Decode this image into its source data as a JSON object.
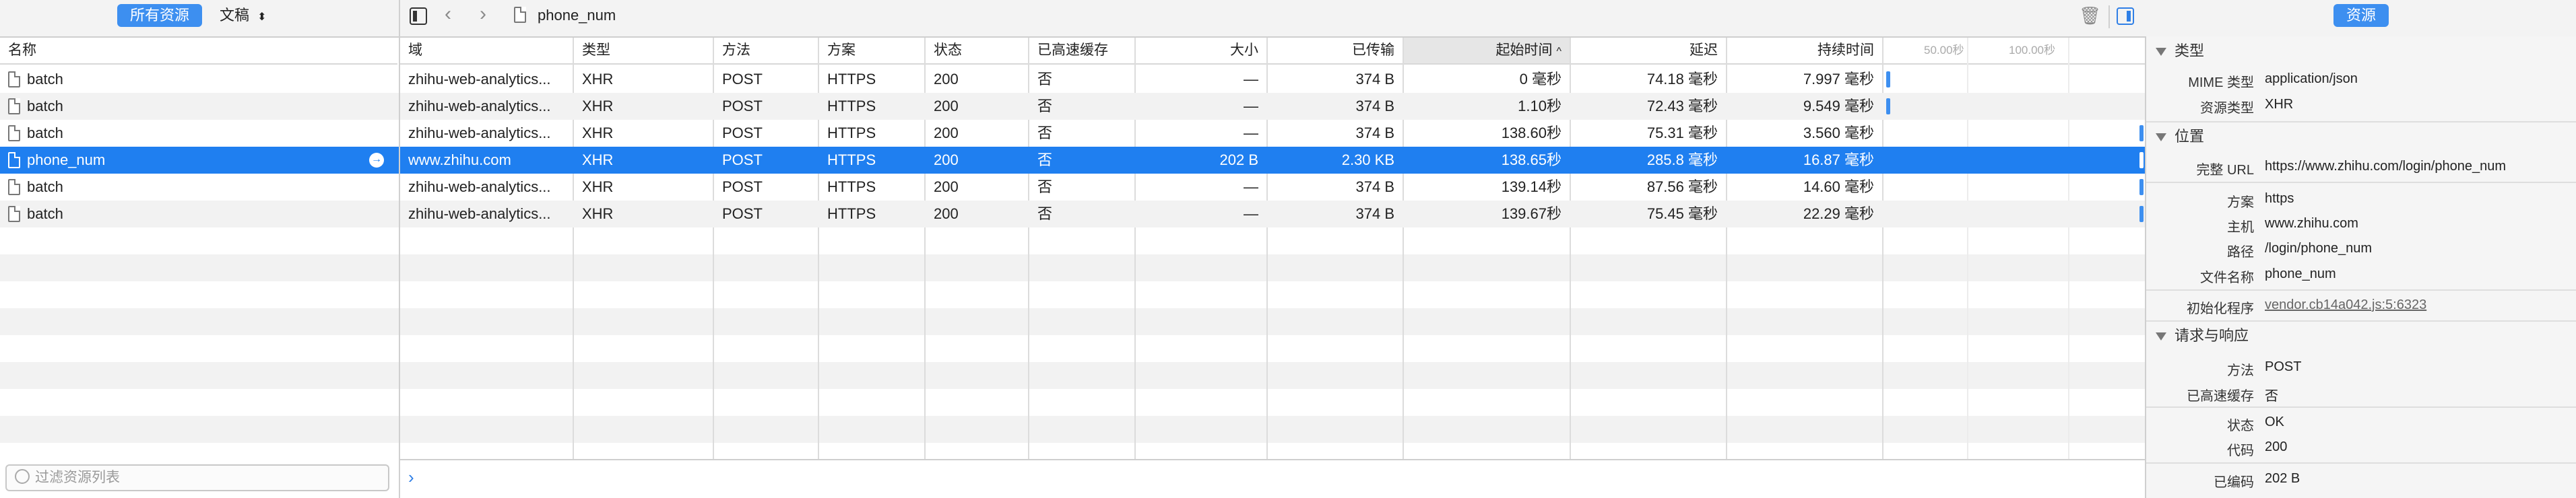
{
  "toolbar": {
    "all_resources_label": "所有资源",
    "document_label": "文稿",
    "breadcrumb_file": "phone_num",
    "right_tab_label": "资源"
  },
  "columns": {
    "name": "名称",
    "domain": "域",
    "type": "类型",
    "method": "方法",
    "scheme": "方案",
    "status": "状态",
    "cached": "已高速缓存",
    "size": "大小",
    "transferred": "已传输",
    "start_time": "起始时间",
    "latency": "延迟",
    "duration": "持续时间",
    "tick_50": "50.00秒",
    "tick_100": "100.00秒"
  },
  "requests": [
    {
      "name": "batch",
      "domain": "zhihu-web-analytics...",
      "type": "XHR",
      "method": "POST",
      "scheme": "HTTPS",
      "status": "200",
      "cached": "否",
      "size": "—",
      "transferred": "374 B",
      "start": "0 毫秒",
      "latency": "74.18 毫秒",
      "duration": "7.997 毫秒",
      "selected": false
    },
    {
      "name": "batch",
      "domain": "zhihu-web-analytics...",
      "type": "XHR",
      "method": "POST",
      "scheme": "HTTPS",
      "status": "200",
      "cached": "否",
      "size": "—",
      "transferred": "374 B",
      "start": "1.10秒",
      "latency": "72.43 毫秒",
      "duration": "9.549 毫秒",
      "selected": false
    },
    {
      "name": "batch",
      "domain": "zhihu-web-analytics...",
      "type": "XHR",
      "method": "POST",
      "scheme": "HTTPS",
      "status": "200",
      "cached": "否",
      "size": "—",
      "transferred": "374 B",
      "start": "138.60秒",
      "latency": "75.31 毫秒",
      "duration": "3.560 毫秒",
      "selected": false
    },
    {
      "name": "phone_num",
      "domain": "www.zhihu.com",
      "type": "XHR",
      "method": "POST",
      "scheme": "HTTPS",
      "status": "200",
      "cached": "否",
      "size": "202 B",
      "transferred": "2.30 KB",
      "start": "138.65秒",
      "latency": "285.8 毫秒",
      "duration": "16.87 毫秒",
      "selected": true
    },
    {
      "name": "batch",
      "domain": "zhihu-web-analytics...",
      "type": "XHR",
      "method": "POST",
      "scheme": "HTTPS",
      "status": "200",
      "cached": "否",
      "size": "—",
      "transferred": "374 B",
      "start": "139.14秒",
      "latency": "87.56 毫秒",
      "duration": "14.60 毫秒",
      "selected": false
    },
    {
      "name": "batch",
      "domain": "zhihu-web-analytics...",
      "type": "XHR",
      "method": "POST",
      "scheme": "HTTPS",
      "status": "200",
      "cached": "否",
      "size": "—",
      "transferred": "374 B",
      "start": "139.67秒",
      "latency": "75.45 毫秒",
      "duration": "22.29 毫秒",
      "selected": false
    }
  ],
  "filter_placeholder": "过滤资源列表",
  "details": {
    "section_type": "类型",
    "mime_label": "MIME 类型",
    "mime_value": "application/json",
    "restype_label": "资源类型",
    "restype_value": "XHR",
    "section_location": "位置",
    "url_label": "完整 URL",
    "url_value": "https://www.zhihu.com/login/phone_num",
    "scheme_label": "方案",
    "scheme_value": "https",
    "host_label": "主机",
    "host_value": "www.zhihu.com",
    "path_label": "路径",
    "path_value": "/login/phone_num",
    "filename_label": "文件名称",
    "filename_value": "phone_num",
    "initiator_label": "初始化程序",
    "initiator_value": "vendor.cb14a042.js:5:6323",
    "section_reqres": "请求与响应",
    "method_label": "方法",
    "method_value": "POST",
    "cached_label": "已高速缓存",
    "cached_value": "否",
    "status_label": "状态",
    "status_value": "OK",
    "code_label": "代码",
    "code_value": "200",
    "encoded_label": "已编码",
    "encoded_value": "202 B"
  },
  "colors": {
    "accent": "#1f7ff0",
    "timeline_bar": "#3d8ff0"
  }
}
